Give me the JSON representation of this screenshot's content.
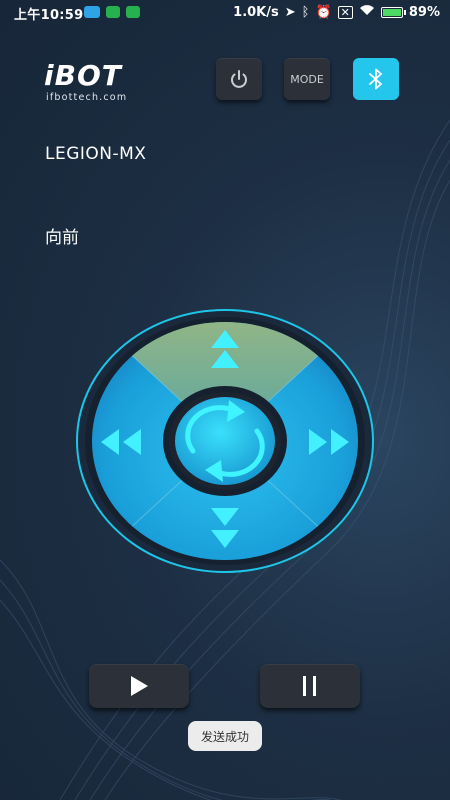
{
  "status_bar": {
    "time": "上午10:59",
    "speed": "1.0K/s",
    "battery_text": "89%",
    "battery_level": 0.89,
    "notifications": [
      "app-notification-icon",
      "app-notification-icon",
      "app-notification-icon"
    ]
  },
  "header": {
    "logo_main": "iBOT",
    "logo_sub": "ifbottech.com",
    "power_icon": "power-icon",
    "mode_label": "MODE",
    "bluetooth_icon": "bluetooth-icon"
  },
  "device_name": "LEGION-MX",
  "direction_label": "向前",
  "dpad": {
    "active_direction": "up",
    "colors": {
      "outer": "#1fa9e0",
      "inner": "#36d6f5",
      "active": "#84b87e",
      "arrow": "#43f0ff",
      "ring": "#1c2430"
    }
  },
  "controls": {
    "play_icon": "play-icon",
    "pause_icon": "pause-icon"
  },
  "toast": "发送成功"
}
